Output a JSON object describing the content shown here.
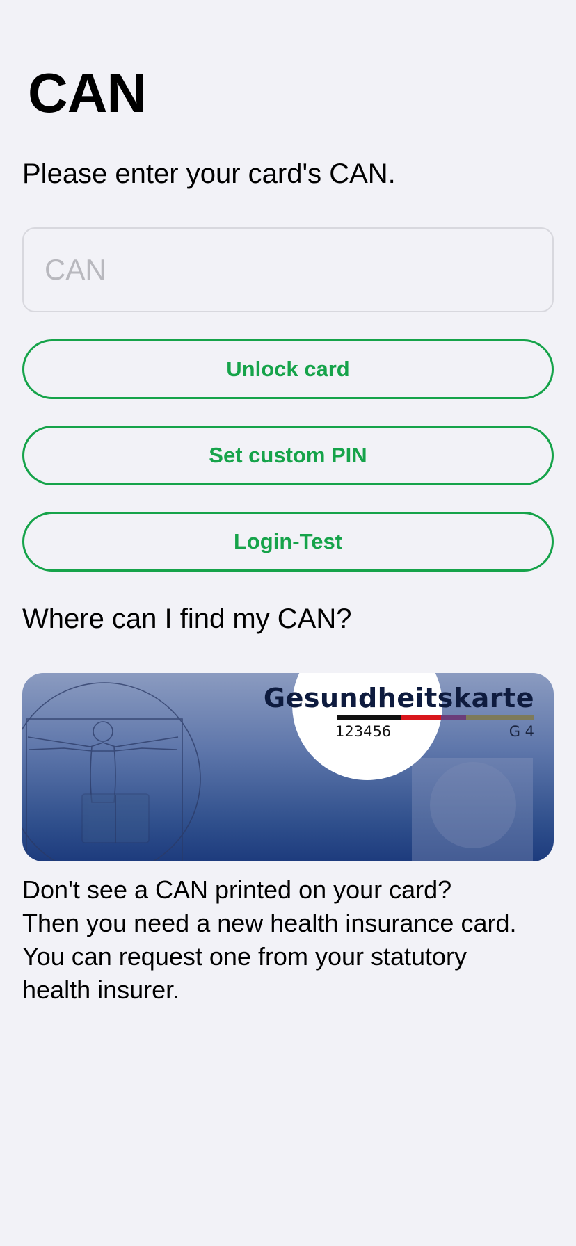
{
  "header": {
    "title": "CAN"
  },
  "form": {
    "instruction": "Please enter your card's CAN.",
    "can_placeholder": "CAN",
    "can_value": ""
  },
  "actions": {
    "unlock_card": "Unlock card",
    "set_custom_pin": "Set custom PIN",
    "login_test": "Login-Test"
  },
  "help": {
    "heading": "Where can I find my CAN?",
    "card_illustration": {
      "brand": "Gesundheitskarte",
      "can_number": "123456",
      "generation": "G 4"
    },
    "lines": [
      "Don't see a CAN printed on your card?",
      "Then you need a new health insurance card.",
      "You can request one from your statutory",
      "health insurer."
    ]
  },
  "colors": {
    "accent": "#16a34a",
    "background": "#f2f2f7",
    "card_top": "#8b9bc0",
    "card_bottom": "#1d3b7d"
  }
}
